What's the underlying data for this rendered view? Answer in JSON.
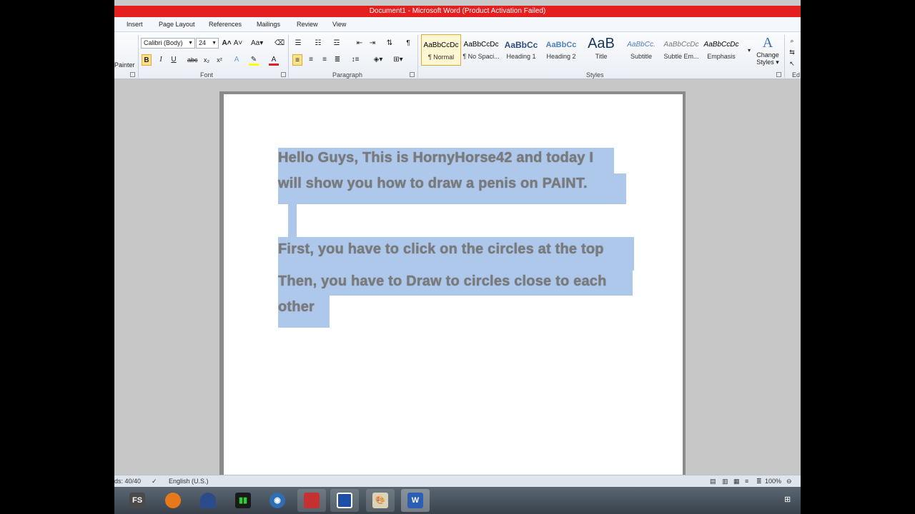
{
  "window": {
    "title": "Document1  -  Microsoft Word (Product Activation Failed)"
  },
  "ribbon_tabs": [
    "Insert",
    "Page Layout",
    "References",
    "Mailings",
    "Review",
    "View"
  ],
  "clipboard": {
    "painter_label": "Painter"
  },
  "font": {
    "family": "Calibri (Body)",
    "size": "24",
    "group_label": "Font",
    "bold": "B",
    "italic": "I",
    "underline": "U",
    "strike": "abc",
    "subscript": "x₂",
    "superscript": "x²"
  },
  "paragraph": {
    "group_label": "Paragraph",
    "pilcrow": "¶"
  },
  "styles": {
    "group_label": "Styles",
    "items": [
      {
        "sample": "AaBbCcDc",
        "name": "¶ Normal"
      },
      {
        "sample": "AaBbCcDc",
        "name": "¶ No Spaci..."
      },
      {
        "sample": "AaBbCc",
        "name": "Heading 1"
      },
      {
        "sample": "AaBbCc",
        "name": "Heading 2"
      },
      {
        "sample": "AaB",
        "name": "Title"
      },
      {
        "sample": "AaBbCc.",
        "name": "Subtitle"
      },
      {
        "sample": "AaBbCcDc",
        "name": "Subtle Em..."
      },
      {
        "sample": "AaBbCcDc",
        "name": "Emphasis"
      }
    ],
    "change_styles_line1": "Change",
    "change_styles_line2": "Styles ▾"
  },
  "editing": {
    "label": "Ed"
  },
  "document": {
    "lines": [
      "Hello Guys, This is HornyHorse42  and today I",
      "will show you how to draw a penis on PAINT.",
      "First, you have to click on the circles at the top",
      "Then, you have to Draw to circles close to each",
      "other"
    ]
  },
  "status": {
    "words": "ds: 40/40",
    "language": "English (U.S.)",
    "zoom": "100%"
  },
  "taskbar": {
    "fs_label": "FS",
    "word_label": "W"
  },
  "colors": {
    "titlebar": "#e41f1f",
    "highlight": "#aec8ec",
    "accent": "#fde28b"
  }
}
